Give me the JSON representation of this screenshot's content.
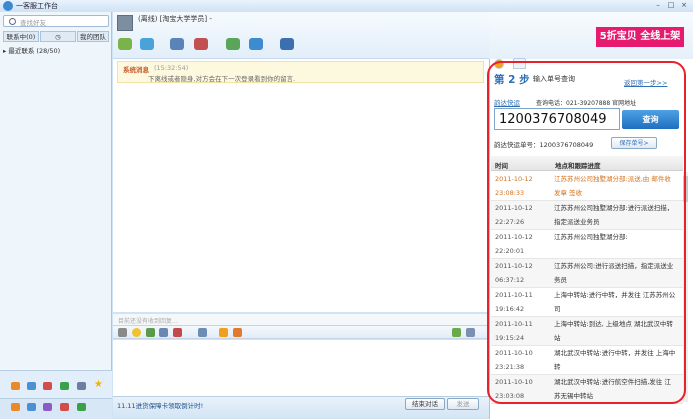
{
  "window": {
    "title": "一客服工作台",
    "buttons": [
      "–",
      "□",
      "×"
    ]
  },
  "left": {
    "search_placeholder": "查找好友",
    "tabs": [
      "联系中(0)",
      "",
      "我的团队"
    ],
    "tree_item": "最近联系 (28/50)"
  },
  "chat": {
    "buddy_name": "(离线) [淘宝大学学员] -",
    "sys_title": "系统消息",
    "sys_time": "(15:32:54)",
    "sys_text": "下离线或者隐身,对方会在下一次登录看到你的留言.",
    "input_hint": "目前还没有收到回复...",
    "promo": "11.11进货保障卡领取倒计时!",
    "close_btn": "结束对话",
    "send_btn": "发送"
  },
  "ad": {
    "text": "5折宝贝 全线上架"
  },
  "tracking": {
    "step_label": "第 2 步",
    "step_sub": "输入单号查询",
    "back_link": "返回第一步>>",
    "carrier": "韵达快运",
    "carrier_phone": "查询电话：021-39207888 官网地址",
    "tracking_number": "1200376708049",
    "query_btn": "查询",
    "waybill_label": "韵达快运单号：1200376708049",
    "save_btn": "保存单号>",
    "col_time": "时间",
    "col_progress": "地点和跟踪进度",
    "rows": [
      {
        "date": "2011-10-12",
        "time": "23:08:33",
        "text": "江苏苏州公司独墅湖分部:派送,由 邮件收发章 签收",
        "highlight": true
      },
      {
        "date": "2011-10-12",
        "time": "22:27:26",
        "text": "江苏苏州公司独墅湖分部:进行派送扫描，指定派送业务员",
        "highlight": false
      },
      {
        "date": "2011-10-12",
        "time": "22:20:01",
        "text": "江苏苏州公司独墅湖分部:",
        "highlight": false
      },
      {
        "date": "2011-10-12",
        "time": "06:37:12",
        "text": "江苏苏州公司:进行派送扫描，指定派送业务员",
        "highlight": false
      },
      {
        "date": "2011-10-11",
        "time": "19:16:42",
        "text": "上海中转站:进行中转，并发往 江苏苏州公司",
        "highlight": false
      },
      {
        "date": "2011-10-11",
        "time": "19:15:24",
        "text": "上海中转站:到达, 上级地点 湖北武汉中转站",
        "highlight": false
      },
      {
        "date": "2011-10-10",
        "time": "23:21:38",
        "text": "湖北武汉中转站:进行中转，并发往 上海中转",
        "highlight": false
      },
      {
        "date": "2011-10-10",
        "time": "23:03:08",
        "text": "湖北武汉中转站:进行航空件扫描,发往 江苏无锡中转站",
        "highlight": false
      }
    ]
  }
}
